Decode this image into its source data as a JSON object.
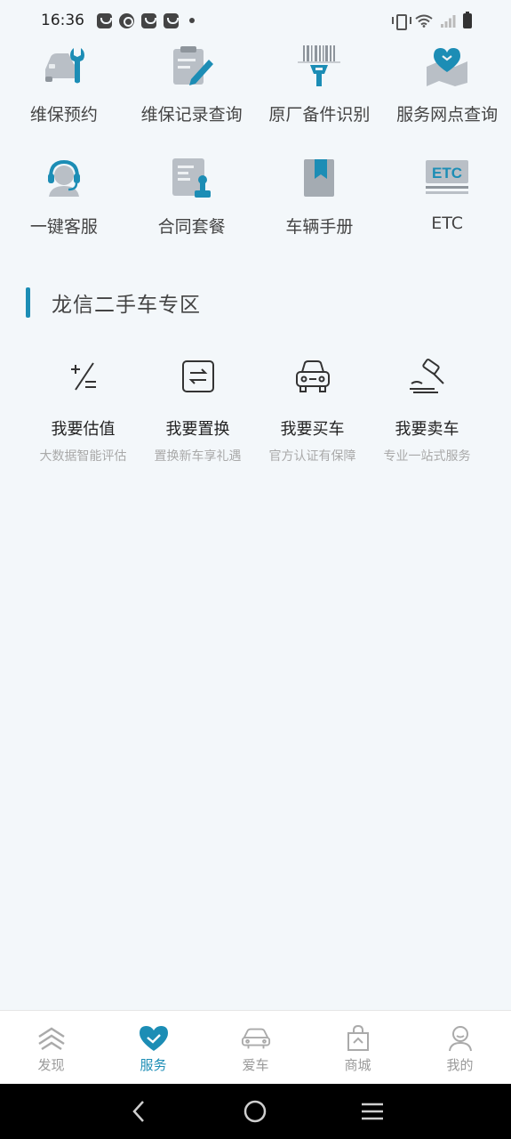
{
  "status_bar": {
    "time": "16:36"
  },
  "services": [
    {
      "label": "维保预约",
      "icon": "wrench-car-icon"
    },
    {
      "label": "维保记录查询",
      "icon": "document-pen-icon"
    },
    {
      "label": "原厂备件识别",
      "icon": "barcode-scanner-icon"
    },
    {
      "label": "服务网点查询",
      "icon": "map-heart-icon"
    },
    {
      "label": "一键客服",
      "icon": "headset-icon"
    },
    {
      "label": "合同套餐",
      "icon": "contract-stamp-icon"
    },
    {
      "label": "车辆手册",
      "icon": "bookmark-book-icon"
    },
    {
      "label": "ETC",
      "icon": "etc-card-icon"
    }
  ],
  "used_car": {
    "title": "龙信二手车专区",
    "items": [
      {
        "title": "我要估值",
        "sub": "大数据智能评估",
        "icon": "plus-minus-icon"
      },
      {
        "title": "我要置换",
        "sub": "置换新车享礼遇",
        "icon": "exchange-icon"
      },
      {
        "title": "我要买车",
        "sub": "官方认证有保障",
        "icon": "car-front-icon"
      },
      {
        "title": "我要卖车",
        "sub": "专业一站式服务",
        "icon": "auction-hammer-icon"
      }
    ]
  },
  "bottom_nav": [
    {
      "label": "发现",
      "icon": "chevrons-logo-icon",
      "active": false
    },
    {
      "label": "服务",
      "icon": "heart-handshake-icon",
      "active": true
    },
    {
      "label": "爱车",
      "icon": "car-icon",
      "active": false
    },
    {
      "label": "商城",
      "icon": "shopping-bag-icon",
      "active": false
    },
    {
      "label": "我的",
      "icon": "user-icon",
      "active": false
    }
  ],
  "colors": {
    "accent": "#1c8db5",
    "background": "#f3f7fa",
    "inactive": "#9a9a9a"
  }
}
